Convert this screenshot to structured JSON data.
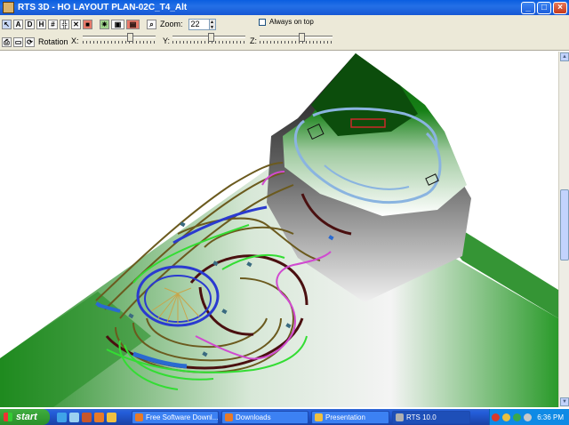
{
  "window": {
    "title": "RTS 3D - HO LAYOUT PLAN-02C_T4_Alt",
    "min_icon": "minimize-icon",
    "max_icon": "maximize-icon",
    "close_icon": "close-icon",
    "min_glyph": "_",
    "max_glyph": "□",
    "close_glyph": "×"
  },
  "toolbar": {
    "btn_a": "A",
    "btn_d": "D",
    "btn_h": "H",
    "zoom_label": "Zoom:",
    "zoom_value": "22",
    "always_on_top": "Always on top",
    "rotation_label": "Rotation",
    "axis_x": "X:",
    "axis_y": "Y:",
    "axis_z": "Z:"
  },
  "taskbar": {
    "start_label": "start",
    "tasks": [
      {
        "label": "Free Software Downl...",
        "icon": "firefox-icon"
      },
      {
        "label": "Downloads",
        "icon": "firefox-icon"
      },
      {
        "label": "Presentation",
        "icon": "folder-icon"
      },
      {
        "label": "RTS 10.0",
        "icon": "rts-app-icon"
      }
    ],
    "clock": "6:36 PM"
  },
  "colors": {
    "titlebar": "#0a5ee0",
    "terrain_green": "#1f8a1f",
    "track_olive": "#6b5a1e",
    "track_blue": "#2a3ad0",
    "track_green": "#33dd33",
    "track_magenta": "#d04ad0",
    "track_maroon": "#4a1010",
    "track_lightblue": "#8ab4e0"
  }
}
